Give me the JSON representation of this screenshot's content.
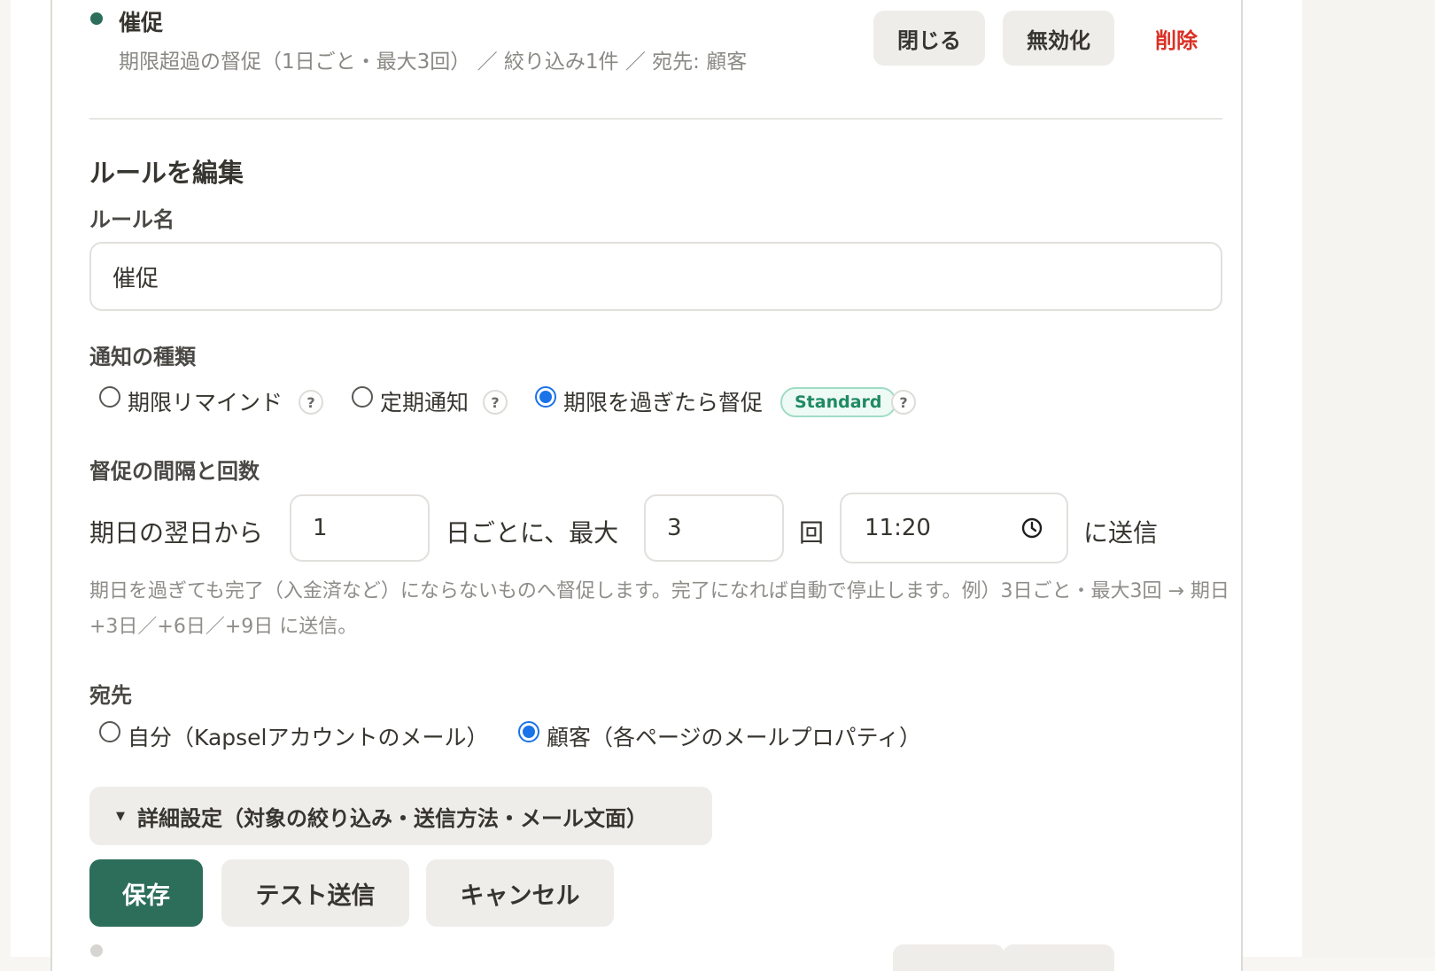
{
  "rule": {
    "title": "催促",
    "summary": "期限超過の督促（1日ごと・最大3回） ／ 絞り込み1件 ／ 宛先: 顧客",
    "actions": {
      "close": "閉じる",
      "disable": "無効化",
      "delete": "削除"
    }
  },
  "editor": {
    "heading": "ルールを編集",
    "name_label": "ルール名",
    "name_value": "催促",
    "type_label": "通知の種類",
    "type_options": [
      {
        "label": "期限リマインド",
        "checked": false
      },
      {
        "label": "定期通知",
        "checked": false
      },
      {
        "label": "期限を過ぎたら督促",
        "checked": true
      }
    ],
    "help_glyph": "?",
    "plan_badge": "Standard",
    "interval_label": "督促の間隔と回数",
    "interval": {
      "prefix": "期日の翌日から",
      "days_value": "1",
      "mid": "日ごとに、最大",
      "count_value": "3",
      "unit": "回",
      "time_value": "11:20",
      "suffix": "に送信"
    },
    "hint": "期日を過ぎても完了（入金済など）にならないものへ督促します。完了になれば自動で停止します。例）3日ごと・最大3回 → 期日+3日／+6日／+9日 に送信。",
    "recipient_label": "宛先",
    "recipient_options": [
      {
        "label": "自分（Kapselアカウントのメール）",
        "checked": false
      },
      {
        "label": "顧客（各ページのメールプロパティ）",
        "checked": true
      }
    ],
    "details_toggle": "詳細設定（対象の絞り込み・送信方法・メール文面）",
    "details_glyph": "▼",
    "buttons": {
      "save": "保存",
      "test": "テスト送信",
      "cancel": "キャンセル"
    }
  },
  "colors": {
    "accent": "#2d6e5b",
    "danger": "#d93025",
    "radio": "#1a73e8",
    "badge_text": "#1f8a63"
  },
  "icons": {
    "status": "dot-icon",
    "time": "clock-icon",
    "toggle": "triangle-down-icon",
    "help": "help-icon"
  }
}
